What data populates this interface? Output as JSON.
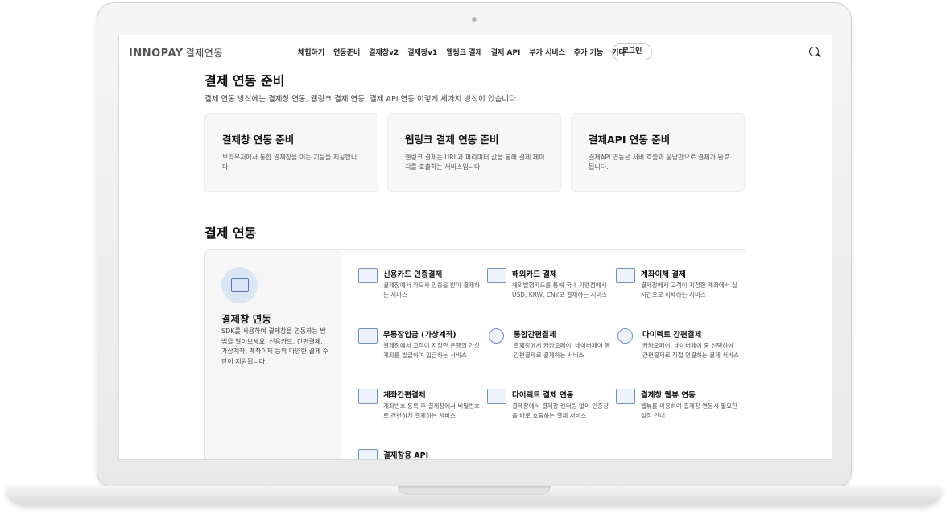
{
  "header": {
    "logo_brand": "INNOPAY",
    "logo_sub": "결제연동",
    "nav": [
      "체험하기",
      "연동준비",
      "결제창v2",
      "결제창v1",
      "웹링크 결제",
      "결제 API",
      "부가 서비스",
      "추가 기능",
      "기타"
    ],
    "login_label": "로그인"
  },
  "prep": {
    "title": "결제 연동 준비",
    "description": "결제 연동 방식에는 결제창 연동, 웹링크 결제 연동, 결제 API 연동 이렇게 세가지 방식이 있습니다.",
    "cards": [
      {
        "title": "결제창 연동 준비",
        "desc": "브라우저에서 통합 결제창을 여는 기능을 제공합니다."
      },
      {
        "title": "웹링크 결제 연동 준비",
        "desc": "웹링크 결제는 URL과 파라미터 값을 통해 결제 페이지를 호출하는 서비스입니다."
      },
      {
        "title": "결제API 연동 준비",
        "desc": "결제API 연동은 서버 호출과 응답만으로 결제가 완료됩니다."
      }
    ]
  },
  "integration": {
    "title": "결제 연동",
    "left_title": "결제창 연동",
    "left_desc": "SDK를 사용하여 결제창을 연동하는 방법을 알아보세요. 신용카드, 간편결제, 가상계좌, 계좌이체 등의 다양한 결제 수단이 지원됩니다.",
    "items": [
      {
        "title": "신용카드 인증결제",
        "desc": "결제창에서 카드사 인증을 받아 결제하는 서비스",
        "icon": "credit-card-icon"
      },
      {
        "title": "해외카드 결제",
        "desc": "해외발행카드를 통해 국내 가맹점에서 USD, KRW, CNY로 결제하는 서비스",
        "icon": "globe-card-icon"
      },
      {
        "title": "계좌이체 결제",
        "desc": "결제창에서 고객이 지정한 계좌에서 실시간으로 이체하는 서비스",
        "icon": "transfer-icon"
      },
      {
        "title": "무통장입금 (가상계좌)",
        "desc": "결제창에서 고객이 지정한 은행의 가상계좌를 발급하여 입금하는 서비스",
        "icon": "virtual-account-icon"
      },
      {
        "title": "통합간편결제",
        "desc": "결제창에서 카카오페이, 네이버페이 등 간편결제로 결제하는 서비스",
        "icon": "pay-icon"
      },
      {
        "title": "다이렉트 간편결제",
        "desc": "카카오페이, 네이버페이 중 선택하여 간편결제로 직접 연결하는 결제 서비스",
        "icon": "direct-pay-icon"
      },
      {
        "title": "계좌간편결제",
        "desc": "계좌번호 등록 후 결제창에서 비밀번호로 간편하게 결제하는 서비스",
        "icon": "account-easy-pay-icon"
      },
      {
        "title": "다이렉트 결제 연동",
        "desc": "결제창에서 결제창 렌더링 없이 인증창을 바로 호출하는 결제 서비스",
        "icon": "direct-link-icon"
      },
      {
        "title": "결제창 웹뷰 연동",
        "desc": "웹뷰를 이용하여 결제창 연동시 필요한 설정 안내",
        "icon": "webview-icon"
      },
      {
        "title": "결제창용 API",
        "desc": "",
        "icon": "api-doc-icon"
      }
    ]
  }
}
